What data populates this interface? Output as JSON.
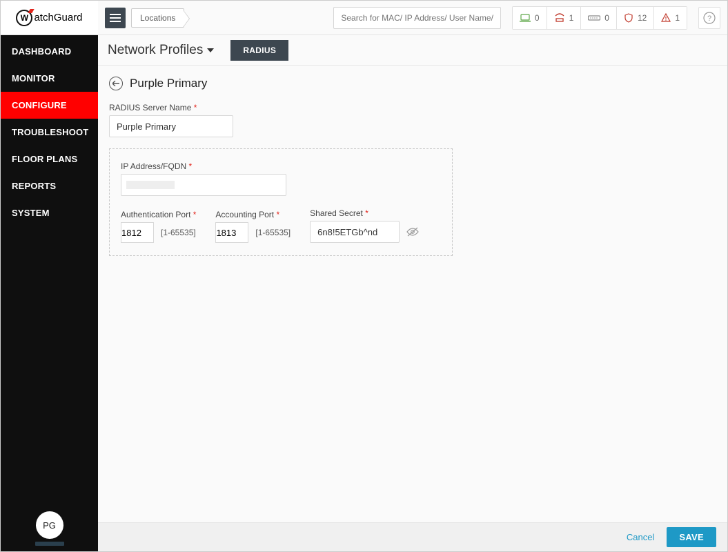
{
  "logo_text": "atchGuard",
  "sidebar": {
    "items": [
      {
        "label": "DASHBOARD"
      },
      {
        "label": "MONITOR"
      },
      {
        "label": "CONFIGURE"
      },
      {
        "label": "TROUBLESHOOT"
      },
      {
        "label": "FLOOR PLANS"
      },
      {
        "label": "REPORTS"
      },
      {
        "label": "SYSTEM"
      }
    ],
    "avatar": "PG"
  },
  "topbar": {
    "breadcrumb": "Locations",
    "search_placeholder": "Search for MAC/ IP Address/ User Name/ Device Name...",
    "stats": {
      "laptop": "0",
      "ap": "1",
      "switch": "0",
      "shield": "12",
      "alert": "1"
    }
  },
  "subheader": {
    "title": "Network Profiles",
    "tab": "RADIUS"
  },
  "page": {
    "title": "Purple Primary",
    "radius_name_label": "RADIUS Server Name",
    "radius_name_value": "Purple Primary",
    "ip_label": "IP Address/FQDN",
    "ip_value": "",
    "auth_port_label": "Authentication Port",
    "auth_port_value": "1812",
    "acct_port_label": "Accounting Port",
    "acct_port_value": "1813",
    "port_hint": "[1-65535]",
    "secret_label": "Shared Secret",
    "secret_value": "6n8!5ETGb^nd"
  },
  "footer": {
    "cancel": "Cancel",
    "save": "SAVE"
  }
}
